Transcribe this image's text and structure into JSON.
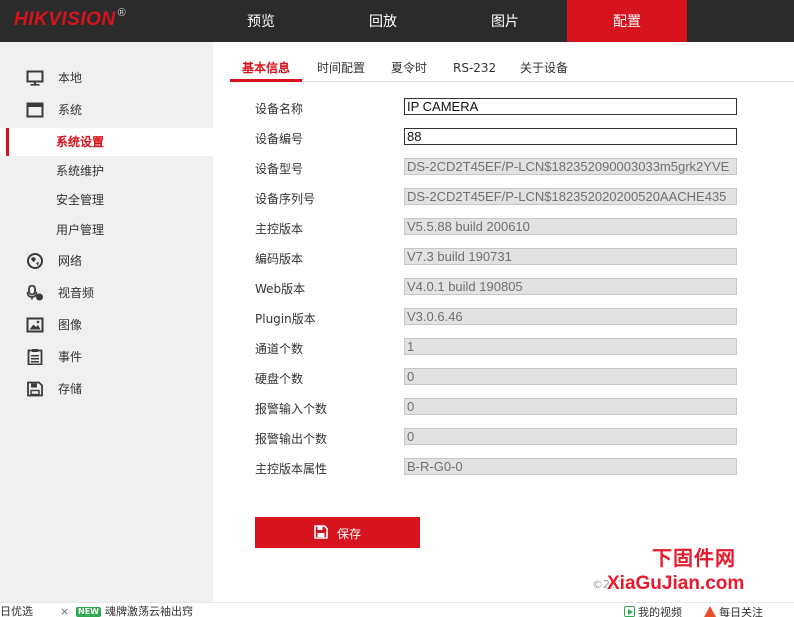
{
  "header": {
    "logo": "HIKVISION",
    "logo_mark": "®",
    "nav": [
      {
        "label": "预览"
      },
      {
        "label": "回放"
      },
      {
        "label": "图片"
      },
      {
        "label": "配置",
        "active": true
      }
    ]
  },
  "sidebar": {
    "items": [
      {
        "label": "本地",
        "icon": "monitor-icon"
      },
      {
        "label": "系统",
        "icon": "system-icon"
      },
      {
        "label": "系统设置",
        "sub": true,
        "active": true
      },
      {
        "label": "系统维护",
        "sub": true
      },
      {
        "label": "安全管理",
        "sub": true
      },
      {
        "label": "用户管理",
        "sub": true
      },
      {
        "label": "网络",
        "icon": "globe-icon"
      },
      {
        "label": "视音频",
        "icon": "microphone-camera-icon"
      },
      {
        "label": "图像",
        "icon": "image-icon"
      },
      {
        "label": "事件",
        "icon": "event-list-icon"
      },
      {
        "label": "存储",
        "icon": "floppy-disk-icon"
      }
    ]
  },
  "tabs": [
    {
      "label": "基本信息",
      "active": true
    },
    {
      "label": "时间配置"
    },
    {
      "label": "夏令时"
    },
    {
      "label": "RS-232"
    },
    {
      "label": "关于设备"
    }
  ],
  "form": {
    "fields": [
      {
        "label": "设备名称",
        "value": "IP CAMERA",
        "editable": true
      },
      {
        "label": "设备编号",
        "value": "88",
        "editable": true
      },
      {
        "label": "设备型号",
        "value": "DS-2CD2T45EF/P-LCN$182352090003033m5grk2YVE",
        "editable": false
      },
      {
        "label": "设备序列号",
        "value": "DS-2CD2T45EF/P-LCN$182352020200520AACHE435",
        "editable": false
      },
      {
        "label": "主控版本",
        "value": "V5.5.88 build 200610",
        "editable": false
      },
      {
        "label": "编码版本",
        "value": "V7.3 build 190731",
        "editable": false
      },
      {
        "label": "Web版本",
        "value": "V4.0.1 build 190805",
        "editable": false
      },
      {
        "label": "Plugin版本",
        "value": "V3.0.6.46",
        "editable": false
      },
      {
        "label": "通道个数",
        "value": "1",
        "editable": false
      },
      {
        "label": "硬盘个数",
        "value": "0",
        "editable": false
      },
      {
        "label": "报警输入个数",
        "value": "0",
        "editable": false
      },
      {
        "label": "报警输出个数",
        "value": "0",
        "editable": false
      },
      {
        "label": "主控版本属性",
        "value": "B-R-G0-0",
        "editable": false
      }
    ],
    "save_label": "保存"
  },
  "footer": {
    "copyright": "©2019"
  },
  "watermark": {
    "title": "下固件网",
    "url": "XiaGuJian.com"
  },
  "statusbar": {
    "left_text": "日优选",
    "close_glyph": "×",
    "new_badge": "NEW",
    "news_text": "魂牌激荡云袖出窍",
    "video_label": "我的视频",
    "hot_label": "每日关注"
  },
  "colors": {
    "brand": "#d7141e",
    "topbar": "#2b2b2b",
    "sidebar": "#f0f0f0",
    "readonly_field": "#e2e2e2"
  }
}
